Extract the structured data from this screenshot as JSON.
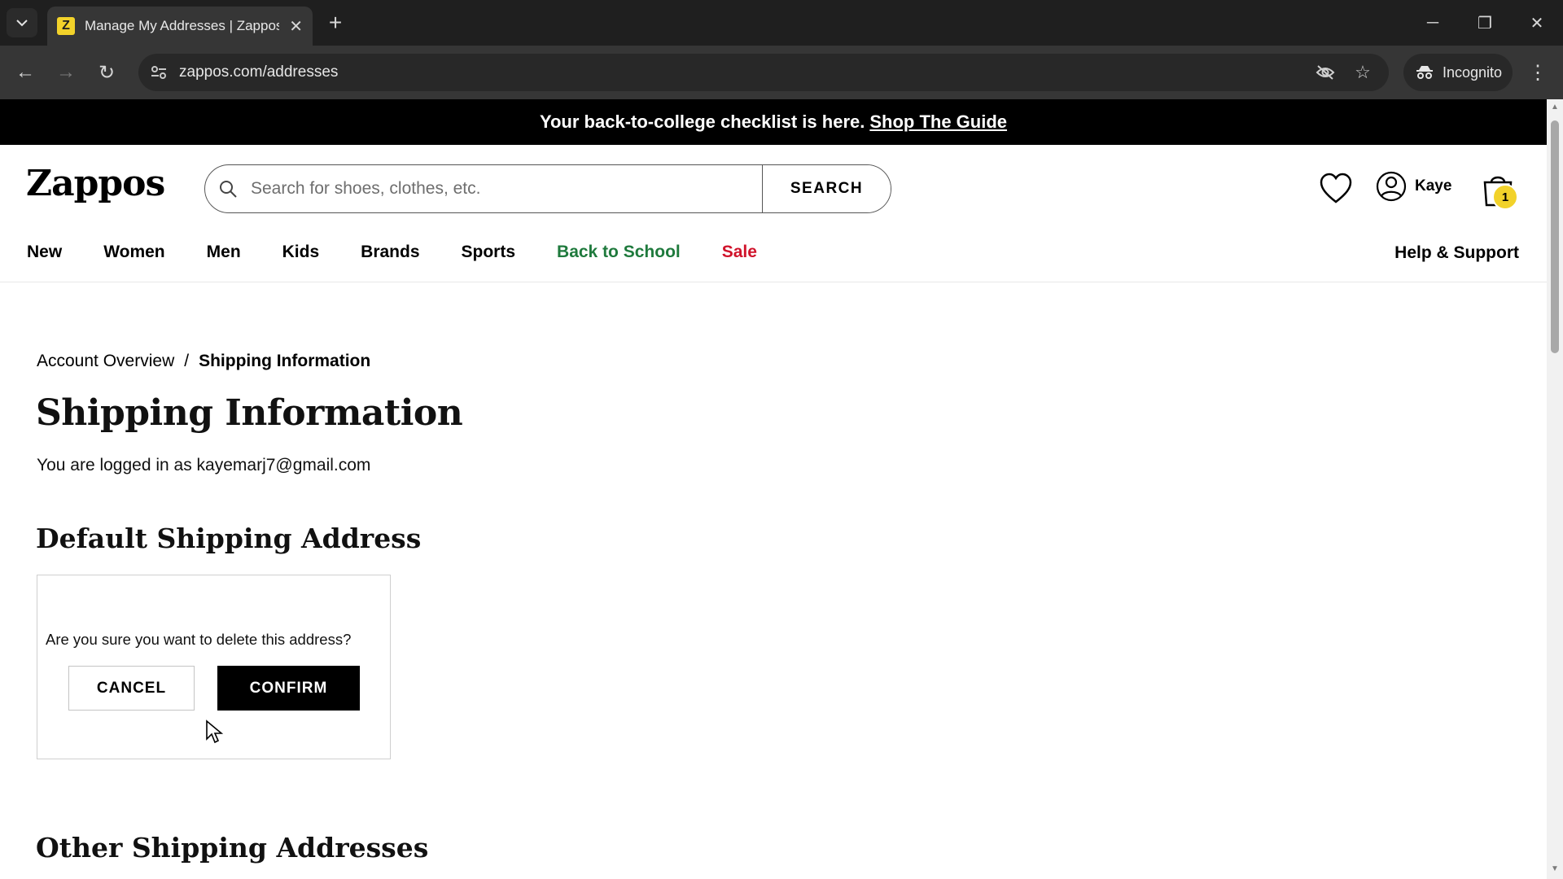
{
  "browser": {
    "tab_title": "Manage My Addresses | Zappos",
    "favicon_letter": "Z",
    "url": "zappos.com/addresses",
    "incognito_label": "Incognito"
  },
  "promo": {
    "text": "Your back-to-college checklist is here.",
    "link": "Shop The Guide"
  },
  "header": {
    "logo": "Zappos",
    "search_placeholder": "Search for shoes, clothes, etc.",
    "search_button": "SEARCH",
    "account_name": "Kaye",
    "cart_count": "1"
  },
  "nav": {
    "items": [
      "New",
      "Women",
      "Men",
      "Kids",
      "Brands",
      "Sports",
      "Back to School",
      "Sale"
    ],
    "help": "Help & Support"
  },
  "breadcrumb": {
    "parent": "Account Overview",
    "separator": "/",
    "current": "Shipping Information"
  },
  "main": {
    "title": "Shipping Information",
    "logged_in": "You are logged in as kayemarj7@gmail.com",
    "default_heading": "Default Shipping Address",
    "confirm_question": "Are you sure you want to delete this address?",
    "cancel_label": "CANCEL",
    "confirm_label": "CONFIRM",
    "other_heading": "Other Shipping Addresses"
  },
  "colors": {
    "accent_yellow": "#f2d22a",
    "nav_school_green": "#1f7a3d",
    "nav_sale_red": "#d0132b"
  }
}
